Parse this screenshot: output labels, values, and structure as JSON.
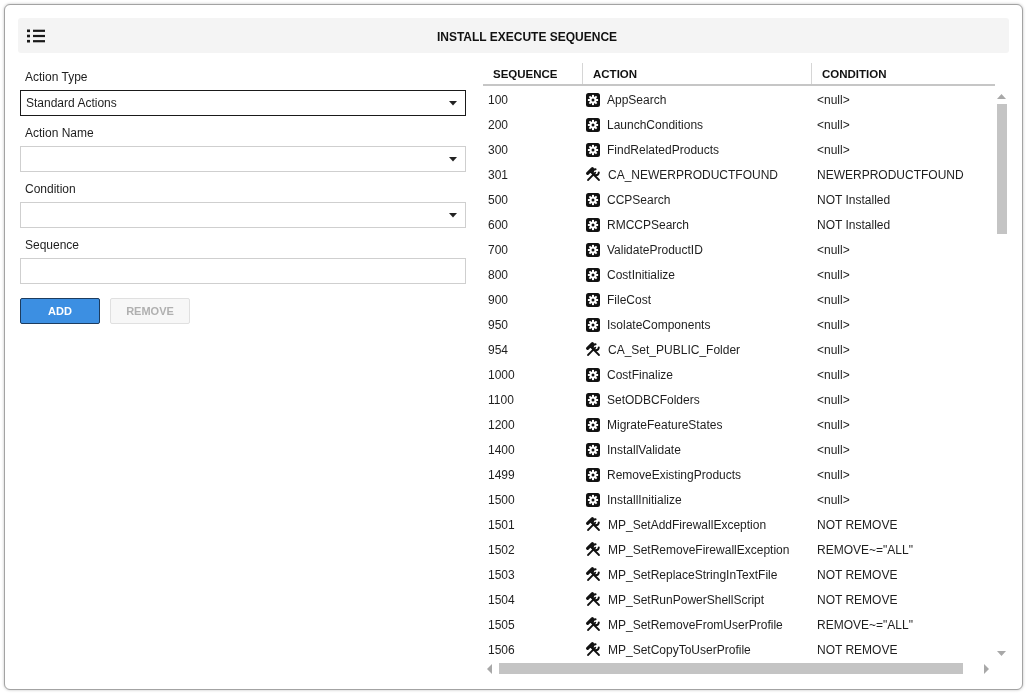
{
  "header": {
    "title": "INSTALL EXECUTE SEQUENCE"
  },
  "form": {
    "fields": [
      {
        "label": "Action Type",
        "kind": "dropdown",
        "value": "Standard Actions",
        "focused": true
      },
      {
        "label": "Action Name",
        "kind": "dropdown",
        "focused": false
      },
      {
        "label": "Condition",
        "kind": "dropdown",
        "focused": false
      },
      {
        "label": "Sequence",
        "kind": "text",
        "focused": false
      }
    ],
    "buttons": [
      {
        "label": "ADD",
        "disabled": false
      },
      {
        "label": "REMOVE",
        "disabled": true
      }
    ]
  },
  "table": {
    "columns": [
      "SEQUENCE",
      "ACTION",
      "CONDITION"
    ],
    "rows": [
      {
        "sequence": "100",
        "kind": "standard",
        "action": "AppSearch",
        "condition": "<null>"
      },
      {
        "sequence": "200",
        "kind": "standard",
        "action": "LaunchConditions",
        "condition": "<null>"
      },
      {
        "sequence": "300",
        "kind": "standard",
        "action": "FindRelatedProducts",
        "condition": "<null>"
      },
      {
        "sequence": "301",
        "kind": "custom",
        "action": "CA_NEWERPRODUCTFOUND",
        "condition": "NEWERPRODUCTFOUND"
      },
      {
        "sequence": "500",
        "kind": "standard",
        "action": "CCPSearch",
        "condition": "NOT Installed"
      },
      {
        "sequence": "600",
        "kind": "standard",
        "action": "RMCCPSearch",
        "condition": "NOT Installed"
      },
      {
        "sequence": "700",
        "kind": "standard",
        "action": "ValidateProductID",
        "condition": "<null>"
      },
      {
        "sequence": "800",
        "kind": "standard",
        "action": "CostInitialize",
        "condition": "<null>"
      },
      {
        "sequence": "900",
        "kind": "standard",
        "action": "FileCost",
        "condition": "<null>"
      },
      {
        "sequence": "950",
        "kind": "standard",
        "action": "IsolateComponents",
        "condition": "<null>"
      },
      {
        "sequence": "954",
        "kind": "custom",
        "action": "CA_Set_PUBLIC_Folder",
        "condition": "<null>"
      },
      {
        "sequence": "1000",
        "kind": "standard",
        "action": "CostFinalize",
        "condition": "<null>"
      },
      {
        "sequence": "1100",
        "kind": "standard",
        "action": "SetODBCFolders",
        "condition": "<null>"
      },
      {
        "sequence": "1200",
        "kind": "standard",
        "action": "MigrateFeatureStates",
        "condition": "<null>"
      },
      {
        "sequence": "1400",
        "kind": "standard",
        "action": "InstallValidate",
        "condition": "<null>"
      },
      {
        "sequence": "1499",
        "kind": "standard",
        "action": "RemoveExistingProducts",
        "condition": "<null>"
      },
      {
        "sequence": "1500",
        "kind": "standard",
        "action": "InstallInitialize",
        "condition": "<null>"
      },
      {
        "sequence": "1501",
        "kind": "custom",
        "action": "MP_SetAddFirewallException",
        "condition": "NOT REMOVE"
      },
      {
        "sequence": "1502",
        "kind": "custom",
        "action": "MP_SetRemoveFirewallException",
        "condition": "REMOVE~=\"ALL\""
      },
      {
        "sequence": "1503",
        "kind": "custom",
        "action": "MP_SetReplaceStringInTextFile",
        "condition": "NOT REMOVE"
      },
      {
        "sequence": "1504",
        "kind": "custom",
        "action": "MP_SetRunPowerShellScript",
        "condition": "NOT REMOVE"
      },
      {
        "sequence": "1505",
        "kind": "custom",
        "action": "MP_SetRemoveFromUserProfile",
        "condition": "REMOVE~=\"ALL\""
      },
      {
        "sequence": "1506",
        "kind": "custom",
        "action": "MP_SetCopyToUserProfile",
        "condition": "NOT REMOVE"
      }
    ]
  }
}
